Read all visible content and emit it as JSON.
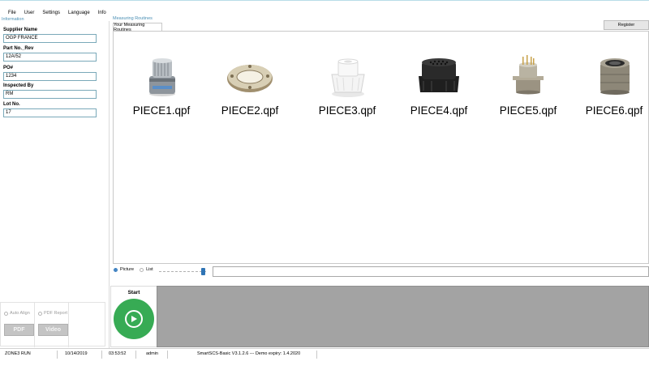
{
  "menu": {
    "items": [
      "File",
      "User",
      "Settings",
      "Language",
      "Info"
    ]
  },
  "information": {
    "group_label": "Information",
    "supplier_name_label": "Supplier Name",
    "supplier_name_value": "OGP FRANCE",
    "part_no_label": "Part No._Rev",
    "part_no_value": "12A/52",
    "po_label": "PO#",
    "po_value": "1234",
    "inspected_by_label": "Inspected By",
    "inspected_by_value": "RM",
    "lot_no_label": "Lot No.",
    "lot_no_value": "17"
  },
  "options": {
    "auto_align_label": "Auto Align",
    "pdf_report_label": "PDF Report",
    "pdf_button_label": "PDF",
    "video_button_label": "Video"
  },
  "routines": {
    "group_label": "Measuring Routines",
    "tab_label": "Your Measuring Routines",
    "register_label": "Register",
    "pieces": [
      {
        "label": "PIECE1.qpf",
        "icon": "knurled-nut-part-image"
      },
      {
        "label": "PIECE2.qpf",
        "icon": "metal-ring-part-image"
      },
      {
        "label": "PIECE3.qpf",
        "icon": "white-plastic-part-image"
      },
      {
        "label": "PIECE4.qpf",
        "icon": "black-connector-part-image"
      },
      {
        "label": "PIECE5.qpf",
        "icon": "pin-connector-part-image"
      },
      {
        "label": "PIECE6.qpf",
        "icon": "round-connector-part-image"
      }
    ]
  },
  "view": {
    "picture_label": "Picture",
    "list_label": "List",
    "selected": "Picture"
  },
  "start": {
    "label": "Start",
    "color": "#37ab54"
  },
  "status": {
    "mode": "ZONE3 RUN",
    "date": "10/14/2019",
    "time": "03:53:52",
    "user": "admin",
    "version": "SmartSCS-Basic V3.1.2.6 --- Demo expiry: 1.4.2020"
  }
}
